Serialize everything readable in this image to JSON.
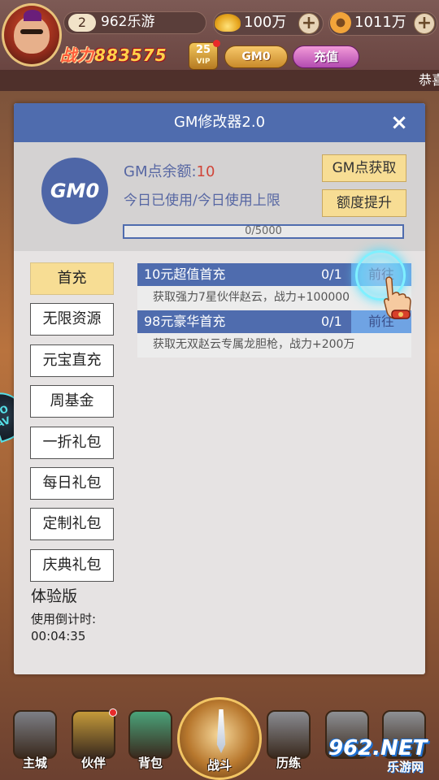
{
  "header": {
    "level": "2",
    "player_name": "962乐游",
    "power_label": "战力",
    "power_value": "883575",
    "vip_level": "25",
    "vip_text": "VIP",
    "gm0_button": "GM0",
    "recharge_button": "充值",
    "gold_value": "100万",
    "coin_value": "1011万",
    "plus_symbol": "+",
    "marquee": "恭喜"
  },
  "side_float": {
    "label": "GO AV"
  },
  "modal": {
    "title": "GM修改器2.0",
    "close_symbol": "×",
    "logo_text": "GM0",
    "balance_label": "GM点余额:",
    "balance_value": "10",
    "usage_label": "今日已使用/今日使用上限",
    "obtain_button": "GM点获取",
    "raise_button": "额度提升",
    "progress_text": "0/5000",
    "progress_fraction": 0
  },
  "sidebar": {
    "items": [
      {
        "label": "首充",
        "active": true
      },
      {
        "label": "无限资源",
        "active": false
      },
      {
        "label": "元宝直充",
        "active": false
      },
      {
        "label": "周基金",
        "active": false
      },
      {
        "label": "一折礼包",
        "active": false
      },
      {
        "label": "每日礼包",
        "active": false
      },
      {
        "label": "定制礼包",
        "active": false
      },
      {
        "label": "庆典礼包",
        "active": false
      }
    ],
    "trial_title": "体验版",
    "countdown_label": "使用倒计时:",
    "countdown_value": "00:04:35"
  },
  "packs": [
    {
      "name": "10元超值首充",
      "count": "0/1",
      "go_label": "前往",
      "desc": "获取强力7星伙伴赵云，战力+100000"
    },
    {
      "name": "98元豪华首充",
      "count": "0/1",
      "go_label": "前往",
      "desc": "获取无双赵云专属龙胆枪，战力+200万"
    }
  ],
  "bottom_nav": {
    "items": [
      {
        "label": "主城",
        "icon": "castle-icon",
        "color": "#7d7f86"
      },
      {
        "label": "伙伴",
        "icon": "companion-icon",
        "color": "#c49a3a"
      },
      {
        "label": "背包",
        "icon": "bag-icon",
        "color": "#4aa37a"
      },
      {
        "label": "历练",
        "icon": "training-icon",
        "color": "#8a8c92"
      },
      {
        "label": "",
        "icon": "locked-feature-icon",
        "color": "#8e9094"
      },
      {
        "label": "",
        "icon": "locked-feature-icon",
        "color": "#8e9094"
      }
    ],
    "battle_label": "战斗"
  },
  "watermark": {
    "logo": "962.NET",
    "sub": "乐游网"
  },
  "colors": {
    "modal_header": "#4f6cae",
    "accent_yellow": "#f7dd94",
    "go_button": "#6fa3e3",
    "balance_red": "#d0463a"
  }
}
